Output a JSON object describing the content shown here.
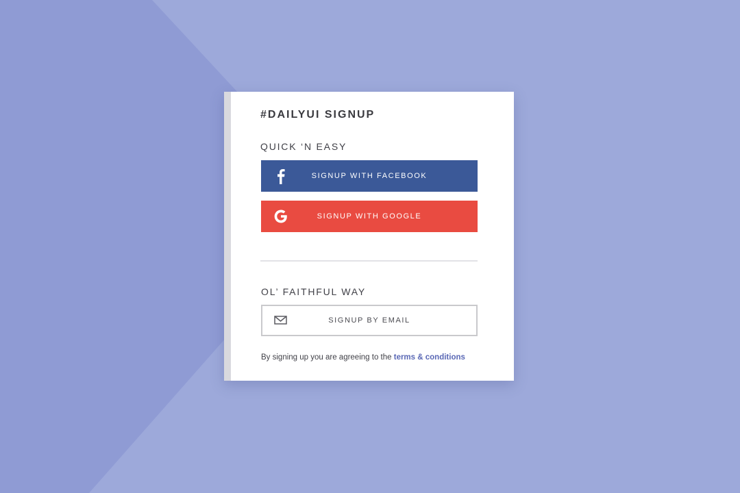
{
  "colors": {
    "background": "#9da9da",
    "background_shade": "#8f9bd4",
    "facebook": "#3b5998",
    "google": "#e94b41",
    "link": "#5a68b5"
  },
  "card": {
    "title": "#DAILYUI SIGNUP",
    "quick_label": "QUICK ‘N EASY",
    "facebook_button": {
      "label": "SIGNUP WITH  FACEBOOK",
      "icon": "facebook-f-icon"
    },
    "google_button": {
      "label": "SIGNUP WITH  GOOGLE",
      "icon": "google-g-icon"
    },
    "faithful_label": "OL’ FAITHFUL WAY",
    "email_button": {
      "label": "SIGNUP BY EMAIL",
      "icon": "envelope-icon"
    },
    "terms": {
      "text": "By signing up you are agreeing to the",
      "link": "terms & conditions"
    }
  }
}
